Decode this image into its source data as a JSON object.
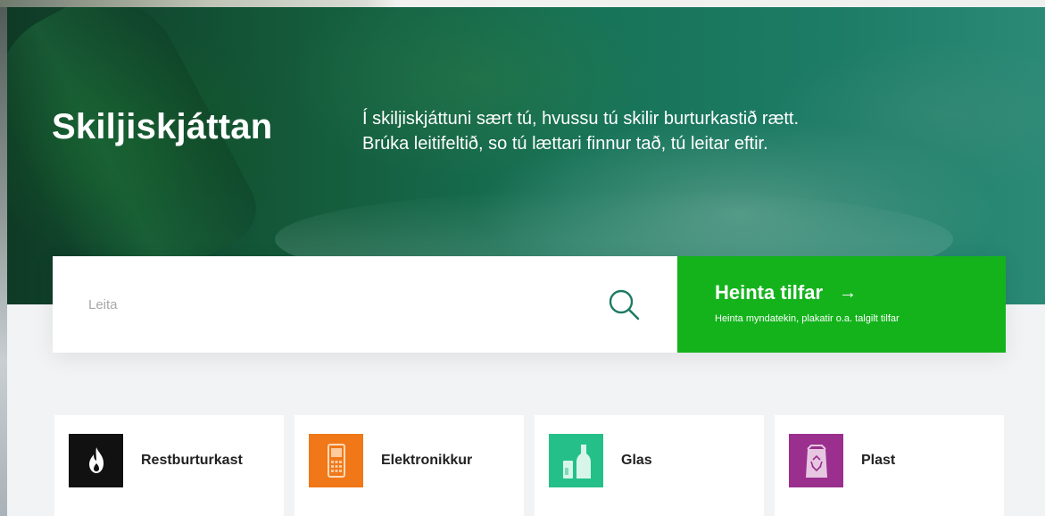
{
  "hero": {
    "title": "Skiljiskjáttan",
    "description_line1": "Í skiljiskjáttuni sært tú, hvussu tú skilir burturkastið rætt.",
    "description_line2": "Brúka leitifeltið, so tú læ­ttari finnur tað, tú leitar eftir."
  },
  "search": {
    "placeholder": "Leita",
    "value": "",
    "icon": "search-icon"
  },
  "cta": {
    "title": "Heinta tilfar",
    "arrow": "→",
    "subtitle": "Heinta myndatekin, plakatir o.a. talgilt tilfar",
    "color": "#14b31c"
  },
  "categories": [
    {
      "label": "Restburturkast",
      "icon": "flame-icon",
      "color": "#111111"
    },
    {
      "label": "Elektronikkur",
      "icon": "phone-icon",
      "color": "#f07818"
    },
    {
      "label": "Glas",
      "icon": "bottles-icon",
      "color": "#25c08a"
    },
    {
      "label": "Plast",
      "icon": "plastic-bag-icon",
      "color": "#9a2f8e"
    }
  ]
}
